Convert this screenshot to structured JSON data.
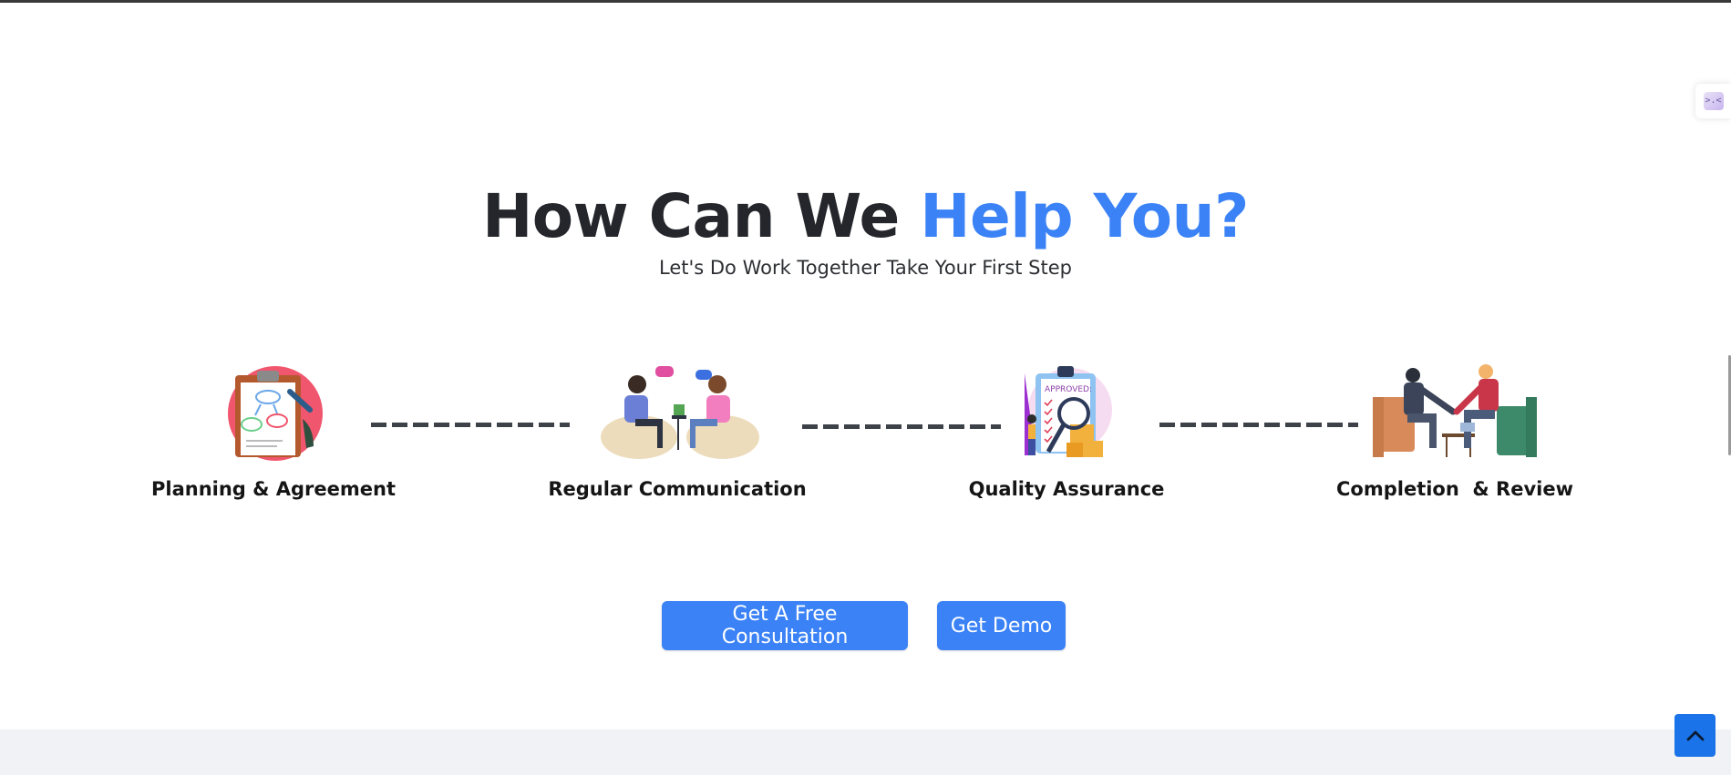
{
  "section": {
    "title_main": "How Can We ",
    "title_accent": "Help You?",
    "subtitle": "Let's Do Work Together Take Your First Step"
  },
  "steps": [
    {
      "label": "Planning & Agreement",
      "icon": "planning-clipboard-icon"
    },
    {
      "label": "Regular Communication",
      "icon": "communication-people-icon"
    },
    {
      "label": "Quality Assurance",
      "icon": "quality-approved-clipboard-icon"
    },
    {
      "label": "Completion  & Review",
      "icon": "completion-handshake-icon"
    }
  ],
  "buttons": {
    "consultation": "Get A Free Consultation",
    "demo": "Get Demo"
  },
  "widgets": {
    "side_widget_icon": "code-widget-icon",
    "scroll_top_icon": "chevron-up-icon"
  },
  "colors": {
    "accent": "#3b82f6",
    "heading": "#24262b",
    "scroll_top": "#1a73e8",
    "footer_band": "#f0f2f6"
  }
}
